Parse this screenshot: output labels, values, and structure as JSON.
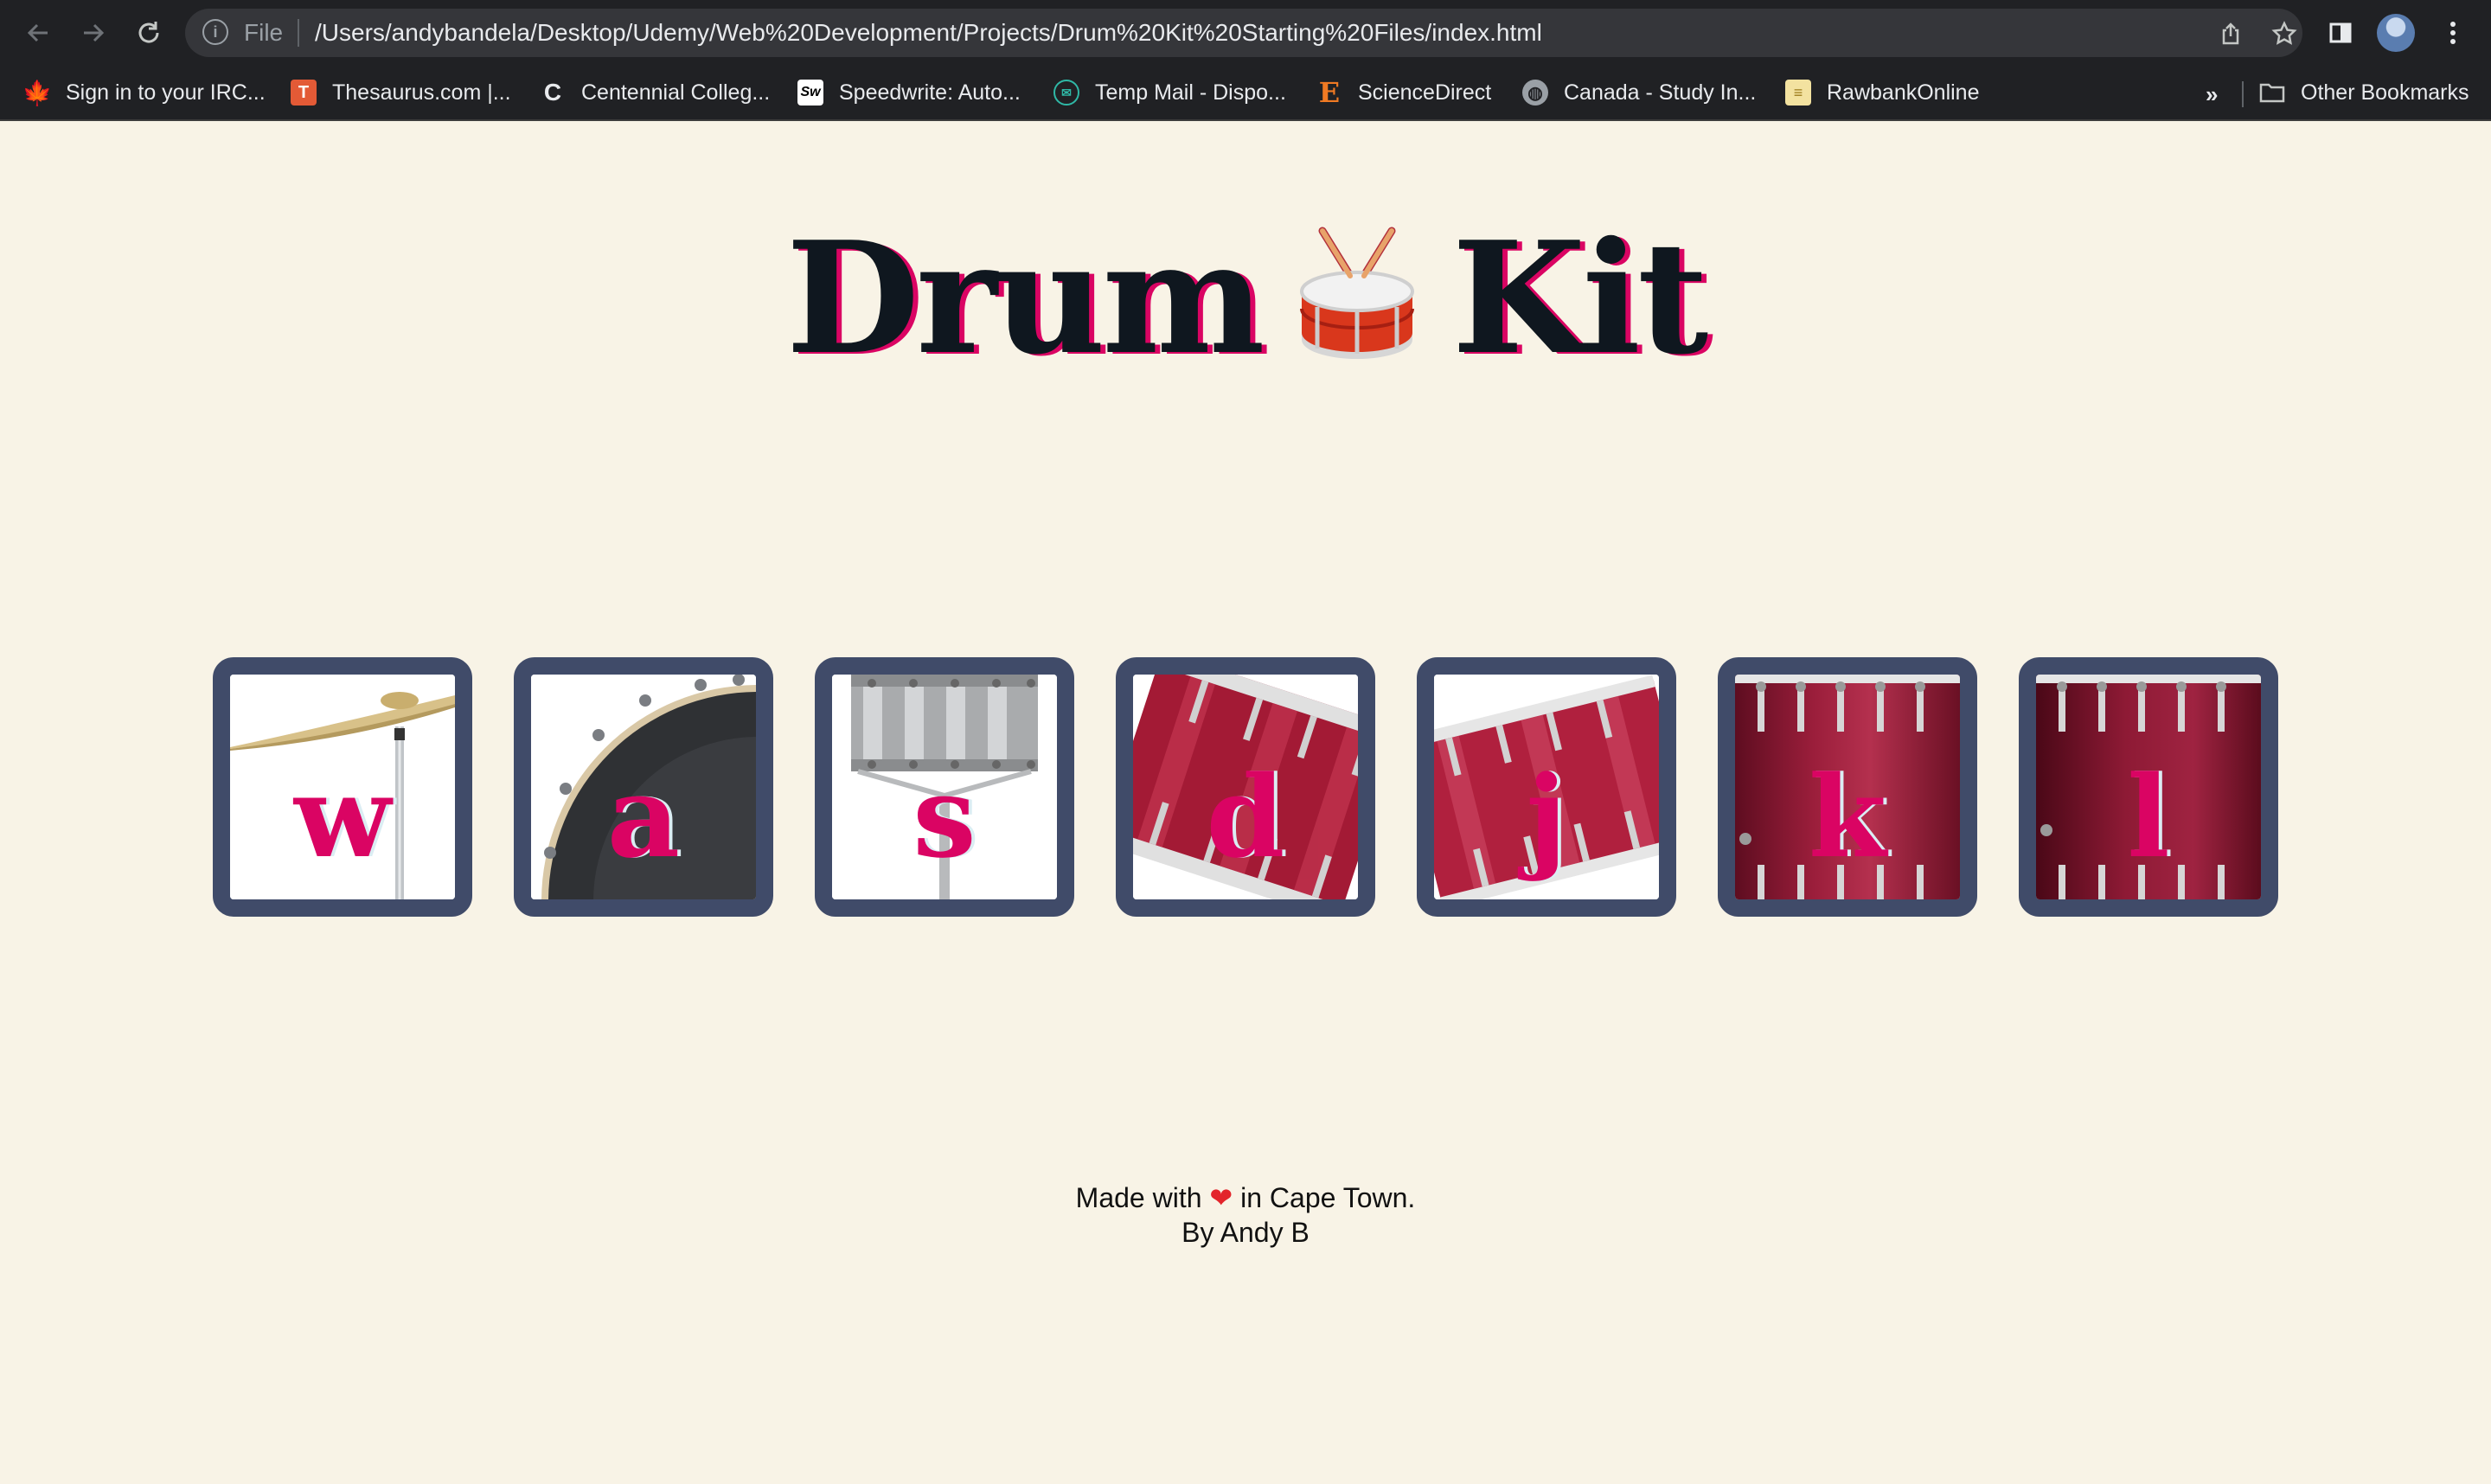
{
  "browser": {
    "scheme_label": "File",
    "url": "/Users/andybandela/Desktop/Udemy/Web%20Development/Projects/Drum%20Kit%20Starting%20Files/index.html",
    "bookmarks": [
      {
        "label": "Sign in to your IRC...",
        "icon": "maple-leaf-icon"
      },
      {
        "label": "Thesaurus.com |...",
        "icon": "thesaurus-icon"
      },
      {
        "label": "Centennial Colleg...",
        "icon": "centennial-icon"
      },
      {
        "label": "Speedwrite: Auto...",
        "icon": "speedwrite-icon"
      },
      {
        "label": "Temp Mail - Dispo...",
        "icon": "tempmail-icon"
      },
      {
        "label": "ScienceDirect",
        "icon": "elsevier-icon"
      },
      {
        "label": "Canada - Study In...",
        "icon": "globe-icon"
      },
      {
        "label": "RawbankOnline",
        "icon": "rawbank-icon"
      }
    ],
    "overflow_label": "»",
    "other_bookmarks": "Other Bookmarks"
  },
  "page": {
    "title_left": "Drum",
    "title_right": "Kit",
    "drums": [
      {
        "key": "w",
        "image": "crash-cymbal"
      },
      {
        "key": "a",
        "image": "kick-bass"
      },
      {
        "key": "s",
        "image": "snare"
      },
      {
        "key": "d",
        "image": "tom-1"
      },
      {
        "key": "j",
        "image": "tom-2"
      },
      {
        "key": "k",
        "image": "tom-3"
      },
      {
        "key": "l",
        "image": "tom-4"
      }
    ],
    "footer_line1_before": "Made with",
    "footer_heart": "❤",
    "footer_line1_after": "in Cape Town.",
    "footer_line2": "By Andy B"
  },
  "colors": {
    "background": "#f8f3e6",
    "title": "#0f171f",
    "accent": "#da0463",
    "drum_border": "#404b69"
  }
}
